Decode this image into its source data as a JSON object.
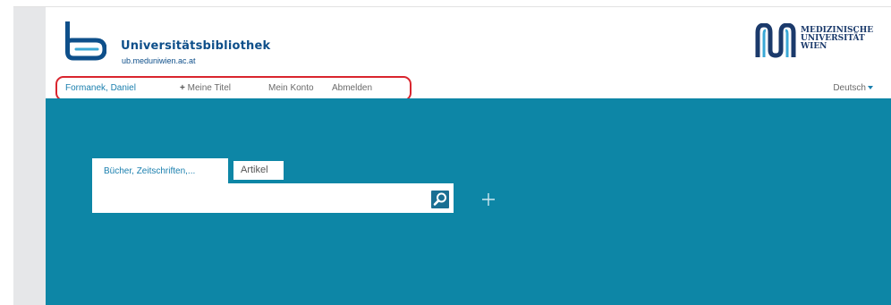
{
  "header": {
    "library_title": "Universitätsbibliothek",
    "library_url": "ub.meduniwien.ac.at",
    "university_name": [
      "MEDIZINISCHE",
      "UNIVERSITÄT",
      "WIEN"
    ]
  },
  "nav": {
    "user_name": "Formanek, Daniel",
    "my_titles_plus": "+",
    "my_titles_label": "Meine Titel",
    "my_account": "Mein Konto",
    "logout": "Abmelden",
    "language": "Deutsch"
  },
  "search": {
    "tabs": [
      {
        "label": "Bücher, Zeitschriften,...",
        "active": true
      },
      {
        "label": "Artikel",
        "active": false
      }
    ],
    "query_value": "",
    "placeholder": ""
  },
  "colors": {
    "brand_blue": "#0e4f8a",
    "teal_background": "#0d86a6",
    "link_blue": "#1a7fae",
    "highlight_red": "#d9252e"
  },
  "icons": {
    "search_button": "magnifier-icon",
    "add_search_field": "plus-icon",
    "language_dropdown": "chevron-down-icon"
  }
}
